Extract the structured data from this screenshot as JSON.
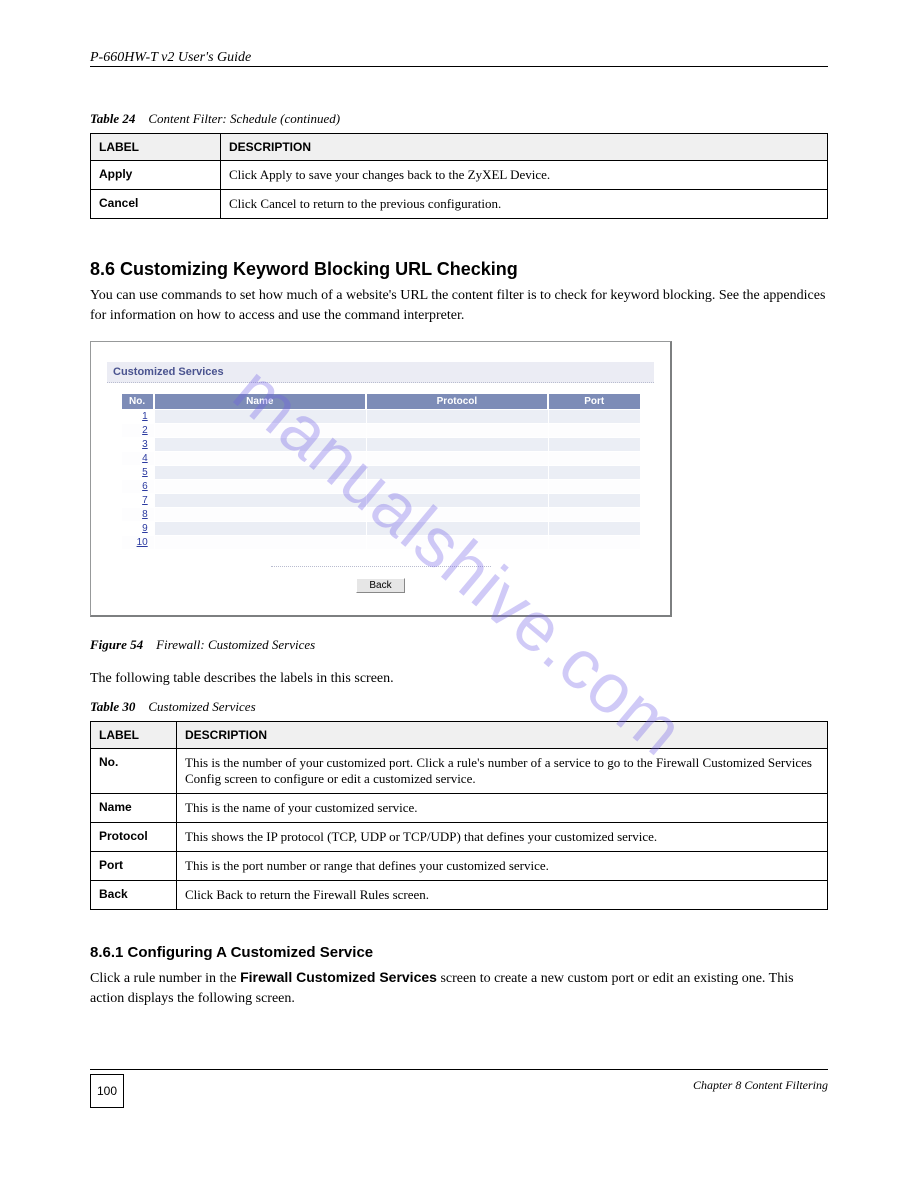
{
  "header": {
    "title": "P-660HW-T v2 User's Guide"
  },
  "button_table": {
    "headers": [
      "LABEL",
      "DESCRIPTION"
    ],
    "rows": [
      {
        "label": "Apply",
        "desc": "Click Apply to save your changes back to the ZyXEL Device."
      },
      {
        "label": "Cancel",
        "desc": "Click Cancel to return to the previous configuration."
      }
    ],
    "caption_prefix": "Table 24",
    "caption_text": "Content Filter: Schedule (continued)"
  },
  "section": {
    "number": "8.6",
    "title": " Customizing Keyword Blocking URL Checking",
    "para": "You can use commands to set how much of a website's URL the content filter is to check for keyword blocking. See the appendices for information on how to access and use the command interpreter."
  },
  "panel": {
    "heading": "Customized Services",
    "cols": {
      "no": "No.",
      "name": "Name",
      "protocol": "Protocol",
      "port": "Port"
    },
    "rows": [
      "1",
      "2",
      "3",
      "4",
      "5",
      "6",
      "7",
      "8",
      "9",
      "10"
    ],
    "back": "Back"
  },
  "figure": {
    "prefix": "Figure 54",
    "text": "Firewall: Customized Services"
  },
  "desc_paragraph": "The following table describes the labels in this screen.",
  "fields_table": {
    "caption_prefix": "Table 30",
    "caption_text": "Customized Services",
    "headers": [
      "LABEL",
      "DESCRIPTION"
    ],
    "rows": [
      {
        "label": "No.",
        "desc": "This is the number of your customized port. Click a rule's number of a service to go to the Firewall Customized Services Config screen to configure or edit a customized service."
      },
      {
        "label": "Name",
        "desc": "This is the name of your customized service."
      },
      {
        "label": "Protocol",
        "desc": "This shows the IP protocol (TCP, UDP or TCP/UDP) that defines your customized service."
      },
      {
        "label": "Port",
        "desc": "This is the port number or range that defines your customized service."
      },
      {
        "label": "Back",
        "desc": "Click Back to return the Firewall Rules screen."
      }
    ]
  },
  "subsection": {
    "number": "8.6.1",
    "title": " Configuring A Customized Service",
    "para_prefix": "Click a rule number in the ",
    "para_mid1": "Firewall Customized Services",
    "para_mid2": " screen to create a new custom port or edit an existing one. This action displays the following screen."
  },
  "footer": {
    "page_num": "100",
    "chapter": "Chapter 8 Content Filtering"
  },
  "watermark": "manualshive.com"
}
